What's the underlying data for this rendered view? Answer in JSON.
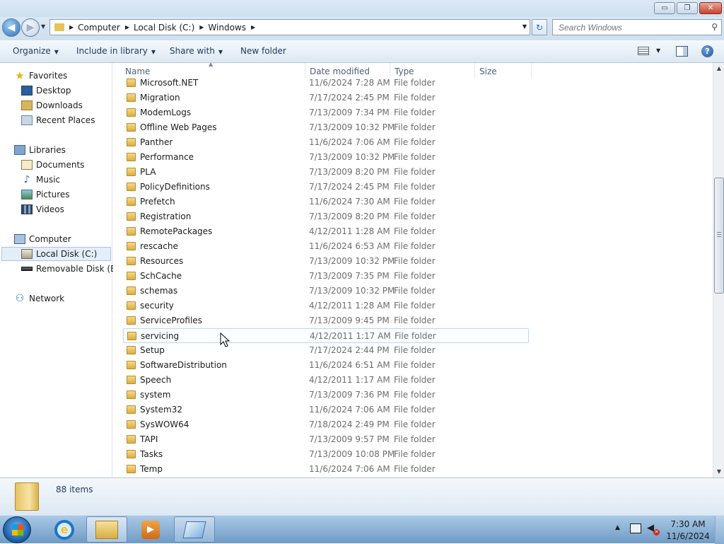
{
  "window": {
    "controls": {
      "minimize": "▭",
      "maximize": "❐",
      "close": "✕"
    }
  },
  "navbar": {
    "back_glyph": "◀",
    "forward_glyph": "▶",
    "breadcrumb": [
      "Computer",
      "Local Disk (C:)",
      "Windows"
    ],
    "refresh_glyph": "↻",
    "search": {
      "placeholder": "Search Windows"
    }
  },
  "toolbar": {
    "organize": "Organize",
    "include_in_library": "Include in library",
    "share_with": "Share with",
    "new_folder": "New folder",
    "help": "?"
  },
  "nav_pane": {
    "favorites": {
      "label": "Favorites",
      "icon": "star-icon"
    },
    "favorites_items": [
      "Desktop",
      "Downloads",
      "Recent Places"
    ],
    "libraries": {
      "label": "Libraries",
      "icon": "library-icon"
    },
    "libraries_items": [
      "Documents",
      "Music",
      "Pictures",
      "Videos"
    ],
    "computer": {
      "label": "Computer",
      "icon": "computer-icon"
    },
    "computer_items": [
      "Local Disk (C:)",
      "Removable Disk (E:)"
    ],
    "network": {
      "label": "Network",
      "icon": "network-icon"
    }
  },
  "columns": {
    "name": "Name",
    "date_modified": "Date modified",
    "type": "Type",
    "size": "Size"
  },
  "files": [
    {
      "name": "Microsoft.NET",
      "date": "11/6/2024 7:28 AM",
      "type": "File folder"
    },
    {
      "name": "Migration",
      "date": "7/17/2024 2:45 PM",
      "type": "File folder"
    },
    {
      "name": "ModemLogs",
      "date": "7/13/2009 7:34 PM",
      "type": "File folder"
    },
    {
      "name": "Offline Web Pages",
      "date": "7/13/2009 10:32 PM",
      "type": "File folder"
    },
    {
      "name": "Panther",
      "date": "11/6/2024 7:06 AM",
      "type": "File folder"
    },
    {
      "name": "Performance",
      "date": "7/13/2009 10:32 PM",
      "type": "File folder"
    },
    {
      "name": "PLA",
      "date": "7/13/2009 8:20 PM",
      "type": "File folder"
    },
    {
      "name": "PolicyDefinitions",
      "date": "7/17/2024 2:45 PM",
      "type": "File folder"
    },
    {
      "name": "Prefetch",
      "date": "11/6/2024 7:30 AM",
      "type": "File folder"
    },
    {
      "name": "Registration",
      "date": "7/13/2009 8:20 PM",
      "type": "File folder"
    },
    {
      "name": "RemotePackages",
      "date": "4/12/2011 1:28 AM",
      "type": "File folder"
    },
    {
      "name": "rescache",
      "date": "11/6/2024 6:53 AM",
      "type": "File folder"
    },
    {
      "name": "Resources",
      "date": "7/13/2009 10:32 PM",
      "type": "File folder"
    },
    {
      "name": "SchCache",
      "date": "7/13/2009 7:35 PM",
      "type": "File folder"
    },
    {
      "name": "schemas",
      "date": "7/13/2009 10:32 PM",
      "type": "File folder"
    },
    {
      "name": "security",
      "date": "4/12/2011 1:28 AM",
      "type": "File folder"
    },
    {
      "name": "ServiceProfiles",
      "date": "7/13/2009 9:45 PM",
      "type": "File folder"
    },
    {
      "name": "servicing",
      "date": "4/12/2011 1:17 AM",
      "type": "File folder"
    },
    {
      "name": "Setup",
      "date": "7/17/2024 2:44 PM",
      "type": "File folder"
    },
    {
      "name": "SoftwareDistribution",
      "date": "11/6/2024 6:51 AM",
      "type": "File folder"
    },
    {
      "name": "Speech",
      "date": "4/12/2011 1:17 AM",
      "type": "File folder"
    },
    {
      "name": "system",
      "date": "7/13/2009 7:36 PM",
      "type": "File folder"
    },
    {
      "name": "System32",
      "date": "11/6/2024 7:06 AM",
      "type": "File folder"
    },
    {
      "name": "SysWOW64",
      "date": "7/18/2024 2:49 PM",
      "type": "File folder"
    },
    {
      "name": "TAPI",
      "date": "7/13/2009 9:57 PM",
      "type": "File folder"
    },
    {
      "name": "Tasks",
      "date": "7/13/2009 10:08 PM",
      "type": "File folder"
    },
    {
      "name": "Temp",
      "date": "11/6/2024 7:06 AM",
      "type": "File folder"
    }
  ],
  "hovered_file": "servicing",
  "details": {
    "item_count": "88 items"
  },
  "taskbar": {
    "pinned": [
      "internet-explorer-icon",
      "windows-explorer-icon",
      "media-player-icon",
      "app-icon"
    ],
    "clock_time": "7:30 AM",
    "clock_date": "11/6/2024"
  }
}
